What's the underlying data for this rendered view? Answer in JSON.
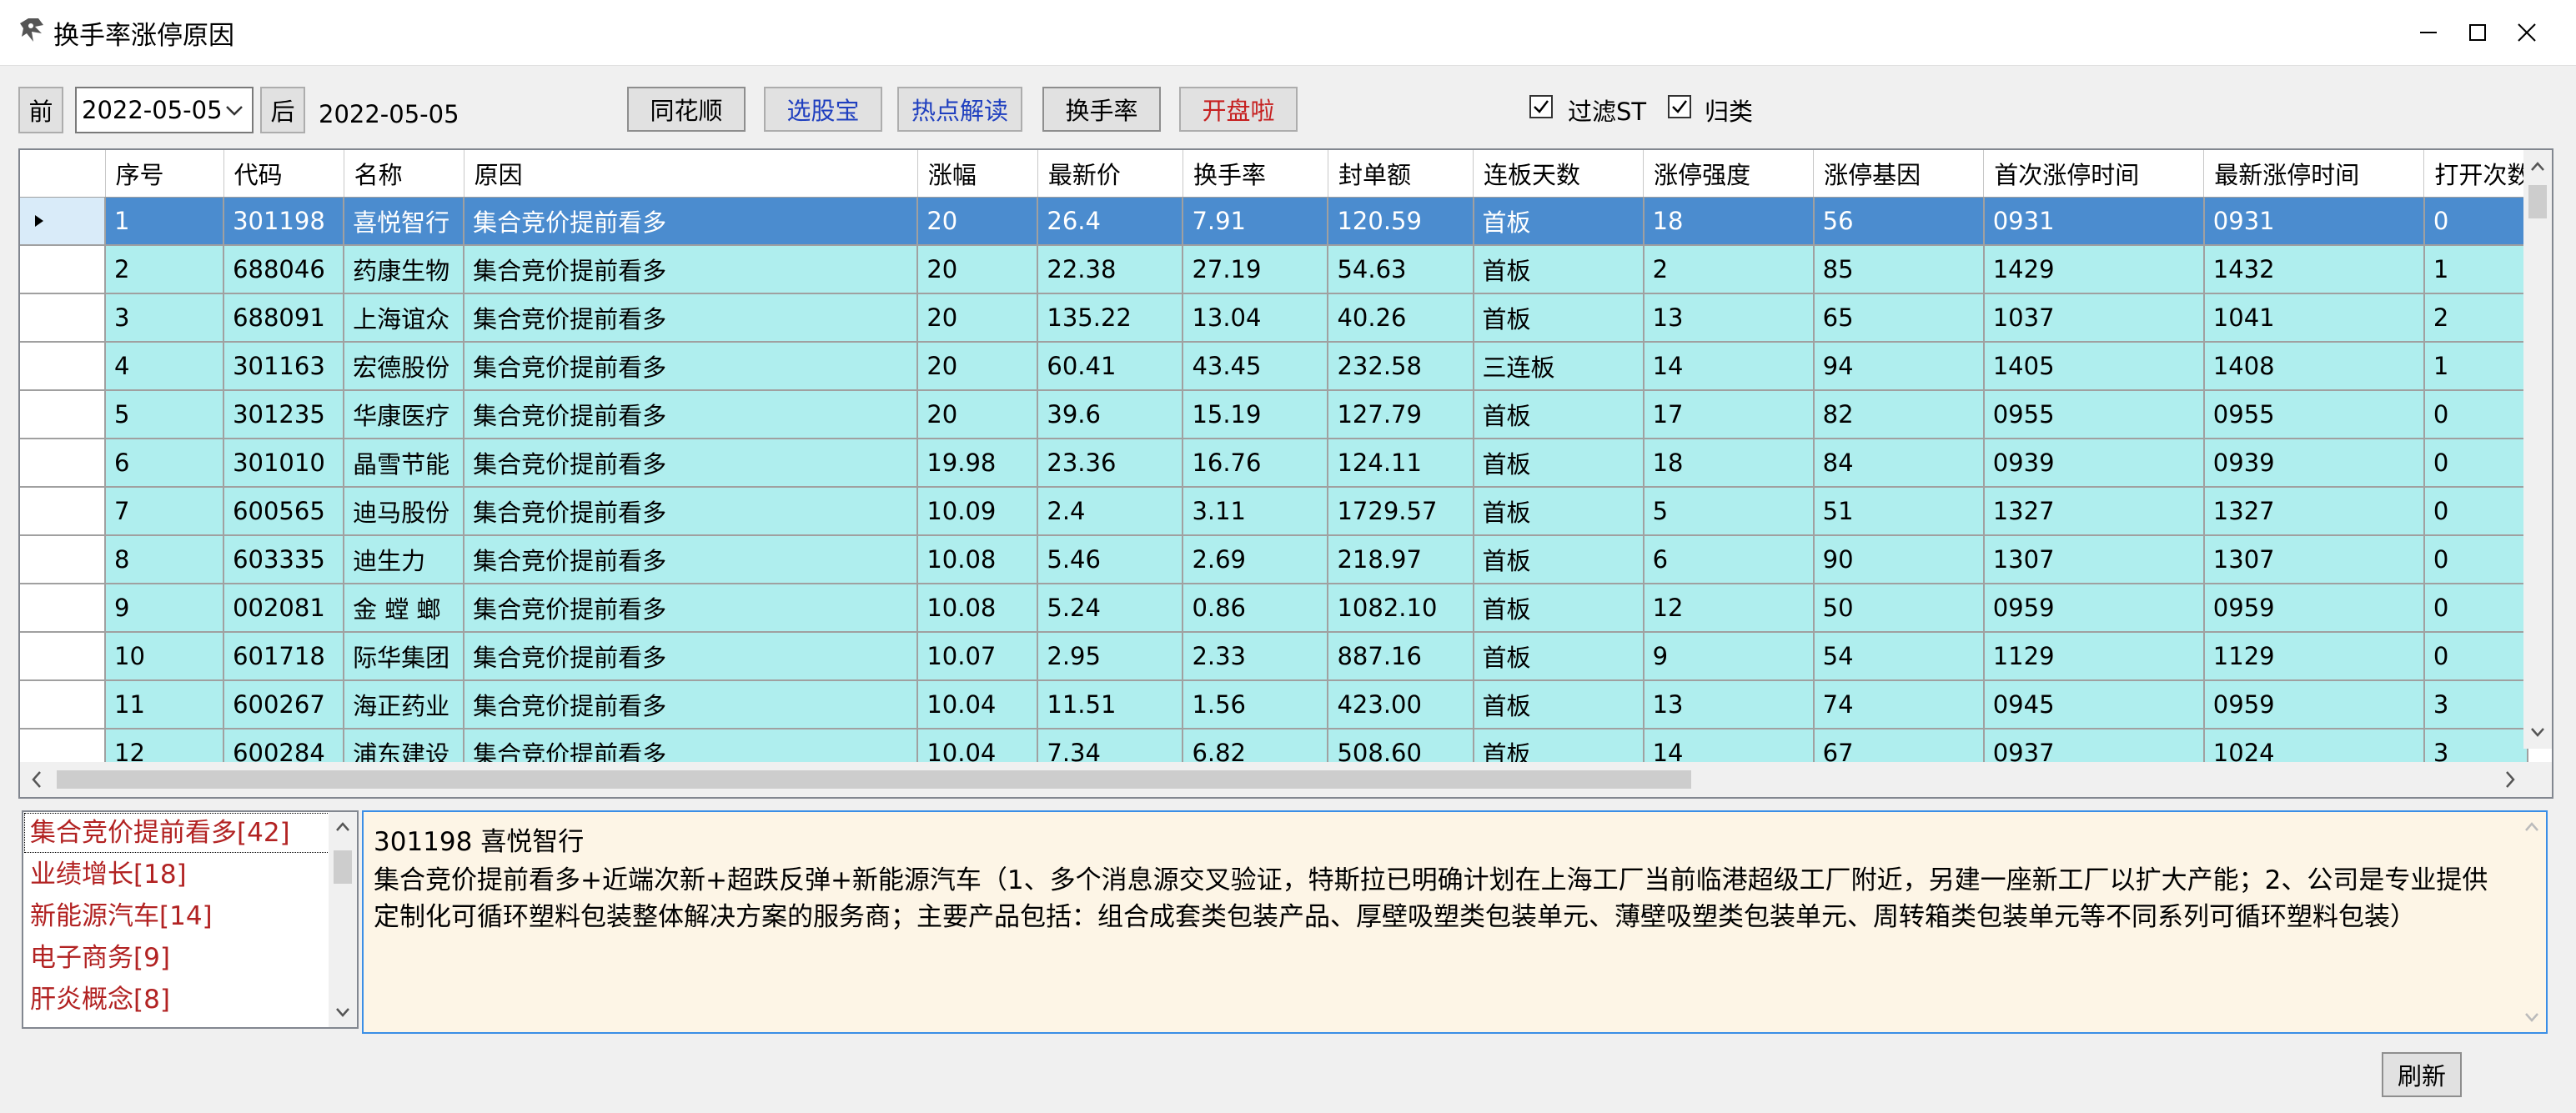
{
  "window": {
    "title": "换手率涨停原因"
  },
  "toolbar": {
    "prev_label": "前",
    "next_label": "后",
    "date_value": "2022-05-05",
    "date_display": "2022-05-05",
    "btn_tonghuashun": "同花顺",
    "btn_xuangubao": "选股宝",
    "btn_redian": "热点解读",
    "btn_huanshoulv": "换手率",
    "btn_kaipanla": "开盘啦",
    "filter_st_label": "过滤ST",
    "filter_st_checked": true,
    "group_label": "归类",
    "group_checked": true
  },
  "grid": {
    "columns": [
      "序号",
      "代码",
      "名称",
      "原因",
      "涨幅",
      "最新价",
      "换手率",
      "封单额",
      "连板天数",
      "涨停强度",
      "涨停基因",
      "首次涨停时间",
      "最新涨停时间",
      "打开次数"
    ],
    "rows": [
      [
        "1",
        "301198",
        "喜悦智行",
        "集合竞价提前看多",
        "20",
        "26.4",
        "7.91",
        "120.59",
        "首板",
        "18",
        "56",
        "0931",
        "0931",
        "0"
      ],
      [
        "2",
        "688046",
        "药康生物",
        "集合竞价提前看多",
        "20",
        "22.38",
        "27.19",
        "54.63",
        "首板",
        "2",
        "85",
        "1429",
        "1432",
        "1"
      ],
      [
        "3",
        "688091",
        "上海谊众",
        "集合竞价提前看多",
        "20",
        "135.22",
        "13.04",
        "40.26",
        "首板",
        "13",
        "65",
        "1037",
        "1041",
        "2"
      ],
      [
        "4",
        "301163",
        "宏德股份",
        "集合竞价提前看多",
        "20",
        "60.41",
        "43.45",
        "232.58",
        "三连板",
        "14",
        "94",
        "1405",
        "1408",
        "1"
      ],
      [
        "5",
        "301235",
        "华康医疗",
        "集合竞价提前看多",
        "20",
        "39.6",
        "15.19",
        "127.79",
        "首板",
        "17",
        "82",
        "0955",
        "0955",
        "0"
      ],
      [
        "6",
        "301010",
        "晶雪节能",
        "集合竞价提前看多",
        "19.98",
        "23.36",
        "16.76",
        "124.11",
        "首板",
        "18",
        "84",
        "0939",
        "0939",
        "0"
      ],
      [
        "7",
        "600565",
        "迪马股份",
        "集合竞价提前看多",
        "10.09",
        "2.4",
        "3.11",
        "1729.57",
        "首板",
        "5",
        "51",
        "1327",
        "1327",
        "0"
      ],
      [
        "8",
        "603335",
        "迪生力",
        "集合竞价提前看多",
        "10.08",
        "5.46",
        "2.69",
        "218.97",
        "首板",
        "6",
        "90",
        "1307",
        "1307",
        "0"
      ],
      [
        "9",
        "002081",
        "金 螳 螂",
        "集合竞价提前看多",
        "10.08",
        "5.24",
        "0.86",
        "1082.10",
        "首板",
        "12",
        "50",
        "0959",
        "0959",
        "0"
      ],
      [
        "10",
        "601718",
        "际华集团",
        "集合竞价提前看多",
        "10.07",
        "2.95",
        "2.33",
        "887.16",
        "首板",
        "9",
        "54",
        "1129",
        "1129",
        "0"
      ],
      [
        "11",
        "600267",
        "海正药业",
        "集合竞价提前看多",
        "10.04",
        "11.51",
        "1.56",
        "423.00",
        "首板",
        "13",
        "74",
        "0945",
        "0959",
        "3"
      ],
      [
        "12",
        "600284",
        "浦东建设",
        "集合竞价提前看多",
        "10.04",
        "7.34",
        "6.82",
        "508.60",
        "首板",
        "14",
        "67",
        "0937",
        "1024",
        "3"
      ]
    ],
    "selected_row": 0
  },
  "categories": [
    "集合竞价提前看多[42]",
    "业绩增长[18]",
    "新能源汽车[14]",
    "电子商务[9]",
    "肝炎概念[8]"
  ],
  "detail": {
    "title": "301198 喜悦智行",
    "body": "集合竞价提前看多+近端次新+超跌反弹+新能源汽车（1、多个消息源交叉验证，特斯拉已明确计划在上海工厂当前临港超级工厂附近，另建一座新工厂以扩大产能；2、公司是专业提供定制化可循环塑料包装整体解决方案的服务商；主要产品包括：组合成套类包装产品、厚壁吸塑类包装单元、薄壁吸塑类包装单元、周转箱类包装单元等不同系列可循环塑料包装）"
  },
  "footer": {
    "refresh_label": "刷新"
  },
  "colors": {
    "row_bg": "#afeeee",
    "selected_bg": "#4b8ccf",
    "category_text": "#b22222",
    "detail_bg": "#fdf5e6"
  }
}
